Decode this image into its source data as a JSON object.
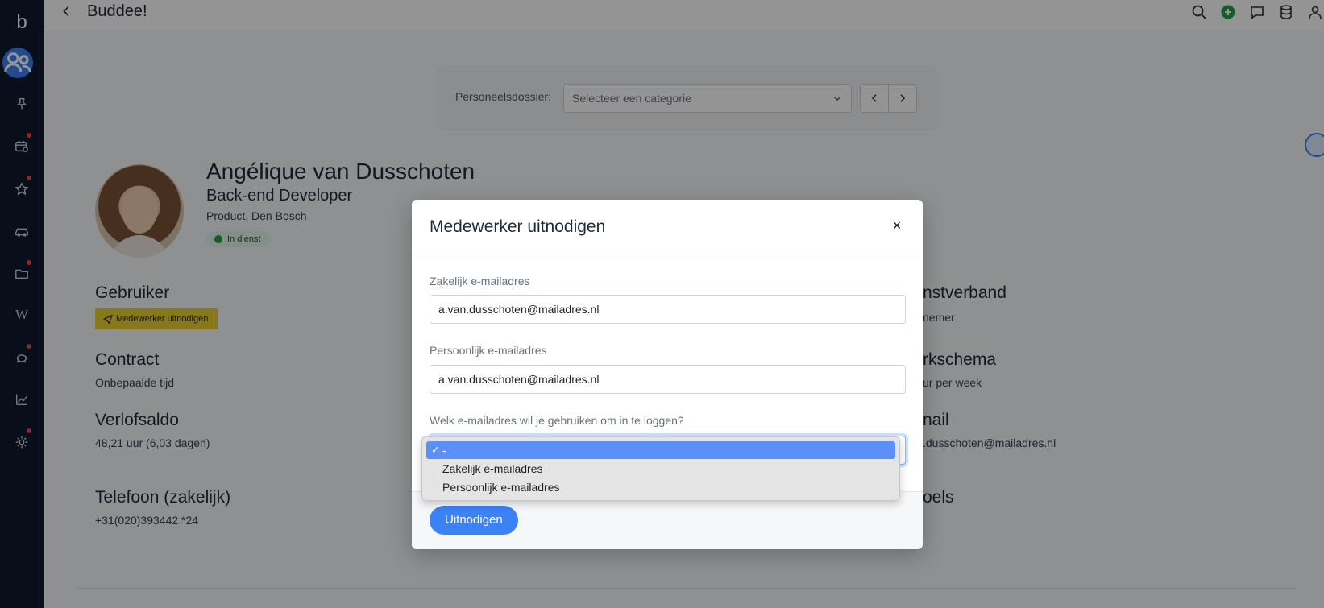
{
  "app": {
    "title": "Buddee!"
  },
  "sidebar": {
    "logo": "b",
    "items": [
      {
        "name": "people",
        "icon": "people-icon",
        "active": true
      },
      {
        "name": "pin",
        "icon": "pin-icon",
        "notify": false
      },
      {
        "name": "calendar",
        "icon": "calendar-icon",
        "notify": true
      },
      {
        "name": "favorites",
        "icon": "star-icon",
        "notify": true
      },
      {
        "name": "car",
        "icon": "car-icon",
        "notify": false
      },
      {
        "name": "folder",
        "icon": "folder-icon",
        "notify": true
      },
      {
        "name": "wiki",
        "icon": "wiki-icon",
        "label": "W",
        "notify": false
      },
      {
        "name": "savings",
        "icon": "piggy-bank-icon",
        "notify": true
      },
      {
        "name": "analytics",
        "icon": "chart-icon",
        "notify": false
      },
      {
        "name": "settings",
        "icon": "gear-icon",
        "notify": true
      }
    ]
  },
  "topbar": {
    "icons": [
      "search-icon",
      "add-icon",
      "chat-icon",
      "database-icon",
      "user-icon"
    ]
  },
  "filter": {
    "label": "Personeelsdossier:",
    "placeholder": "Selecteer een categorie"
  },
  "profile": {
    "name": "Angélique van Dusschoten",
    "role": "Back-end Developer",
    "department": "Product, Den Bosch",
    "status": "In dienst"
  },
  "fields": {
    "user_heading": "Gebruiker",
    "invite_chip": "Medewerker uitnodigen",
    "contract_heading": "Contract",
    "contract_value": "Onbepaalde tijd",
    "leave_heading": "Verlofsaldo",
    "leave_value": "48,21 uur (6,03 dagen)",
    "phone_heading": "Telefoon (zakelijk)",
    "phone_value": "+31(020)393442 *24",
    "employment_heading_partial": "nstverband",
    "employment_value_partial": "nemer",
    "schedule_heading_partial": "rkschema",
    "schedule_value_partial": "ur per week",
    "email_heading_partial": "nail",
    "email_value_partial": ".dusschoten@mailadres.nl",
    "mobile_heading_partial": "oels"
  },
  "modal": {
    "title": "Medewerker uitnodigen",
    "close": "×",
    "business_label": "Zakelijk e-mailadres",
    "business_value": "a.van.dusschoten@mailadres.nl",
    "personal_label": "Persoonlijk e-mailadres",
    "personal_value": "a.van.dusschoten@mailadres.nl",
    "login_label": "Welk e-mailadres wil je gebruiken om in te loggen?",
    "submit": "Uitnodigen"
  },
  "dropdown": {
    "options": [
      "-",
      "Zakelijk e-mailadres",
      "Persoonlijk e-mailadres"
    ],
    "selected": "-",
    "check": "✓"
  },
  "colors": {
    "sidebar": "#0f1b2d",
    "accent": "#3b82f6",
    "chip": "#e8d12c",
    "status_green": "#22a047"
  }
}
